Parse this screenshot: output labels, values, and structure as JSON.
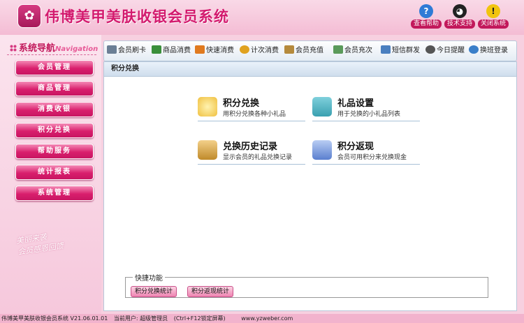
{
  "header": {
    "app_title": "伟博美甲美肤收银会员系统",
    "logo_glyph": "✿",
    "tools": [
      {
        "label": "查看帮助",
        "icon": "help-icon",
        "glyph": "?",
        "color": "#2f7bd6"
      },
      {
        "label": "技术支持",
        "icon": "qq-penguin-icon",
        "glyph": "◕",
        "color": "#222222"
      },
      {
        "label": "关闭系统",
        "icon": "warning-icon",
        "glyph": "!",
        "color": "#f1c40f"
      }
    ]
  },
  "sidebar": {
    "title": "系统导航",
    "title_en": "Navigation",
    "items": [
      {
        "label": "会员管理"
      },
      {
        "label": "商品管理"
      },
      {
        "label": "消费收银"
      },
      {
        "label": "积分兑换"
      },
      {
        "label": "帮助服务"
      },
      {
        "label": "统计报表"
      },
      {
        "label": "系统管理"
      }
    ],
    "deco_text": "美丽来袭\n会员感恩回馈"
  },
  "toolbar": {
    "items": [
      {
        "label": "会员刷卡",
        "icon": "card-reader-icon",
        "color": "#6b7f95"
      },
      {
        "label": "商品消费",
        "icon": "shopping-icon",
        "color": "#3a8f3a"
      },
      {
        "label": "快速消费",
        "icon": "fast-consume-icon",
        "color": "#e07a1f"
      },
      {
        "label": "计次消费",
        "icon": "count-consume-icon",
        "color": "#e0a21f"
      },
      {
        "label": "会员充值",
        "icon": "recharge-icon",
        "color": "#b58a3c"
      },
      {
        "label": "会员充次",
        "icon": "recharge-count-icon",
        "color": "#5a9a5a"
      },
      {
        "label": "短信群发",
        "icon": "sms-icon",
        "color": "#4a7fbf"
      },
      {
        "label": "今日提醒",
        "icon": "reminder-icon",
        "color": "#555555"
      },
      {
        "label": "换班登录",
        "icon": "shift-login-icon",
        "color": "#3a7fc9"
      }
    ]
  },
  "main": {
    "panel_title": "积分兑换",
    "cards": [
      {
        "title": "积分兑换",
        "desc": "用积分兑换各种小礼品",
        "icon": "points-exchange-icon",
        "color": "#f0c040"
      },
      {
        "title": "礼品设置",
        "desc": "用于兑换的小礼品列表",
        "icon": "gift-settings-icon",
        "color": "#3aa0b0"
      },
      {
        "title": "兑换历史记录",
        "desc": "显示会员的礼品兑换记录",
        "icon": "history-icon",
        "color": "#c08a2a"
      },
      {
        "title": "积分返现",
        "desc": "会员可用积分来兑换现金",
        "icon": "points-cashback-icon",
        "color": "#5a7fcf"
      }
    ],
    "quick": {
      "title": "快捷功能",
      "buttons": [
        {
          "label": "积分兑换统计"
        },
        {
          "label": "积分返现统计"
        }
      ]
    }
  },
  "status": {
    "version": "伟博美甲美肤收银会员系统 V21.06.01.01",
    "user": "当前用户: 超级管理员",
    "lock_hint": "(Ctrl+F12锁定屏幕)",
    "website": "www.yzweber.com"
  }
}
